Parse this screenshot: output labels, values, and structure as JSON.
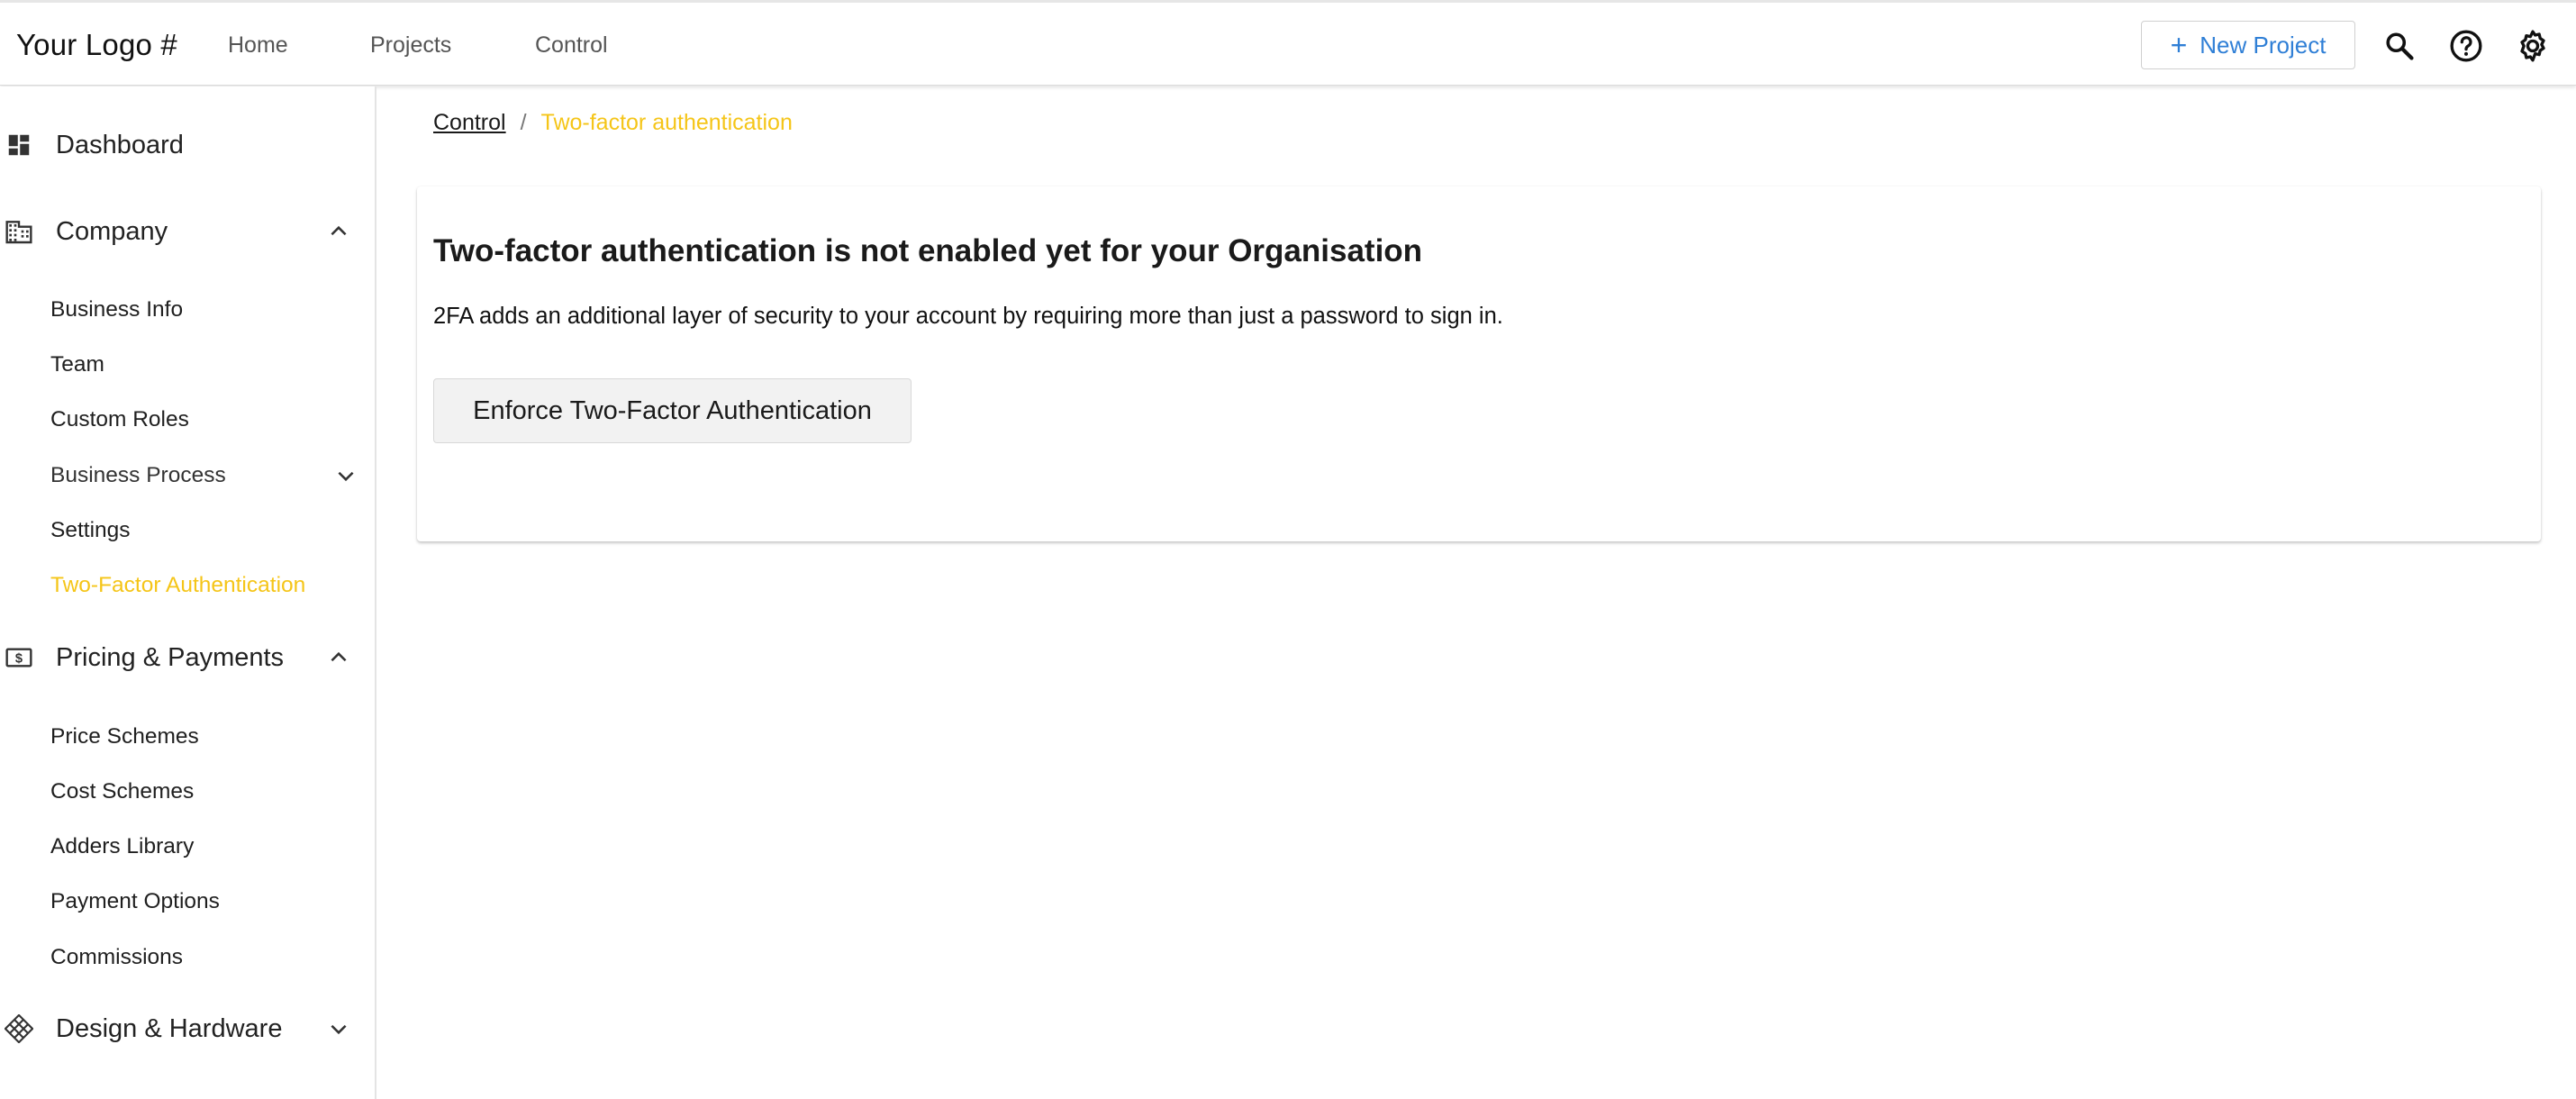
{
  "app": {
    "logo": "Your Logo #"
  },
  "topnav": {
    "links": [
      "Home",
      "Projects",
      "Control"
    ],
    "new_project_label": "New Project",
    "icons": [
      "search-icon",
      "help-icon",
      "settings-icon"
    ]
  },
  "sidebar": {
    "dashboard": "Dashboard",
    "company": {
      "label": "Company",
      "items": [
        "Business Info",
        "Team",
        "Custom Roles",
        "Business Process",
        "Settings",
        "Two-Factor Authentication"
      ]
    },
    "pricing": {
      "label": "Pricing & Payments",
      "items": [
        "Price Schemes",
        "Cost Schemes",
        "Adders Library",
        "Payment Options",
        "Commissions"
      ]
    },
    "design": {
      "label": "Design & Hardware"
    }
  },
  "breadcrumb": {
    "parent": "Control",
    "separator": "/",
    "current": "Two-factor authentication"
  },
  "card": {
    "title": "Two-factor authentication is not enabled yet for your Organisation",
    "description": "2FA adds an additional layer of security to your account by requiring more than just a password to sign in.",
    "button_label": "Enforce Two-Factor Authentication"
  },
  "colors": {
    "accent_yellow": "#f5c518",
    "link_blue": "#2f7fd6"
  }
}
